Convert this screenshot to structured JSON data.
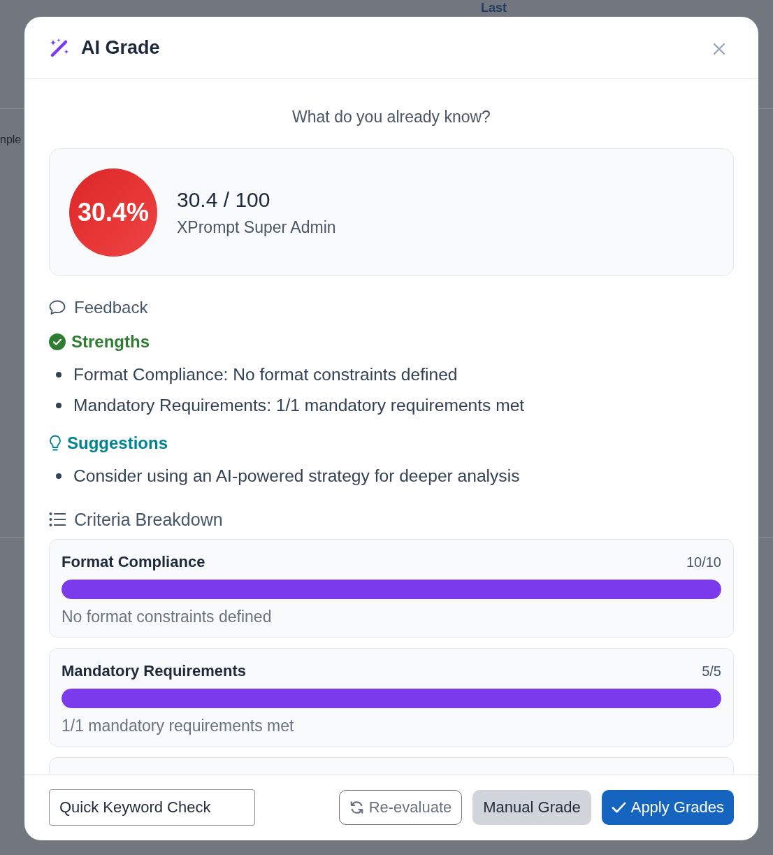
{
  "backdrop": {
    "top_fragment": "Last",
    "left_fragment": "nple"
  },
  "dialog": {
    "title": "AI Grade"
  },
  "prompt": "What do you already know?",
  "score": {
    "percent": "30.4%",
    "points": "30.4 / 100",
    "grader": "XPrompt Super Admin"
  },
  "feedback": {
    "title": "Feedback",
    "sections": [
      {
        "kind": "strengths",
        "title": "Strengths",
        "items": [
          "Format Compliance: No format constraints defined",
          "Mandatory Requirements: 1/1 mandatory requirements met"
        ]
      },
      {
        "kind": "suggestions",
        "title": "Suggestions",
        "items": [
          "Consider using an AI-powered strategy for deeper analysis"
        ]
      }
    ]
  },
  "criteria": {
    "title": "Criteria Breakdown",
    "items": [
      {
        "name": "Format Compliance",
        "score": "10/10",
        "level": 1,
        "note": "No format constraints defined"
      },
      {
        "name": "Mandatory Requirements",
        "score": "5/5",
        "level": 1,
        "note": "1/1 mandatory requirements met"
      }
    ]
  },
  "footer": {
    "strategy_field": {
      "value": "Quick Keyword Check"
    },
    "buttons": [
      {
        "kind": "outline",
        "label": "Re-evaluate"
      },
      {
        "kind": "secondary",
        "label": "Manual Grade"
      },
      {
        "kind": "primary",
        "label": "Apply Grades"
      }
    ]
  }
}
